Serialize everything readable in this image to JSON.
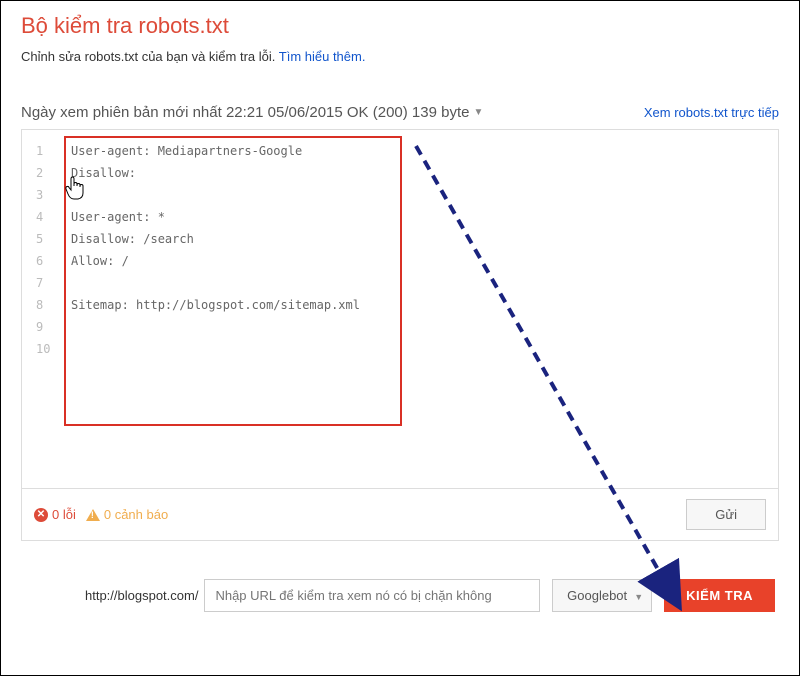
{
  "header": {
    "title": "Bộ kiểm tra robots.txt",
    "subtitle_text": "Chỉnh sửa robots.txt của bạn và kiểm tra lỗi. ",
    "subtitle_link": "Tìm hiểu thêm."
  },
  "version": {
    "text": "Ngày xem phiên bản mới nhất 22:21 05/06/2015 OK (200) 139 byte",
    "view_live": "Xem robots.txt trực tiếp"
  },
  "code": {
    "line1": "User-agent: Mediapartners-Google",
    "line2": "Disallow:",
    "line3": "",
    "line4": "User-agent: *",
    "line5": "Disallow: /search",
    "line6": "Allow: /",
    "line7": "",
    "line8": "Sitemap: http://blogspot.com/sitemap.xml"
  },
  "status": {
    "errors": "0 lỗi",
    "warnings": "0 cảnh báo",
    "submit_label": "Gửi"
  },
  "test": {
    "url_prefix": "http://blogspot.com/",
    "url_placeholder": "Nhập URL để kiểm tra xem nó có bị chặn không",
    "selected_bot": "Googlebot",
    "test_button": "KIỂM TRA"
  },
  "line_nums": {
    "n1": "1",
    "n2": "2",
    "n3": "3",
    "n4": "4",
    "n5": "5",
    "n6": "6",
    "n7": "7",
    "n8": "8",
    "n9": "9",
    "n10": "10"
  }
}
